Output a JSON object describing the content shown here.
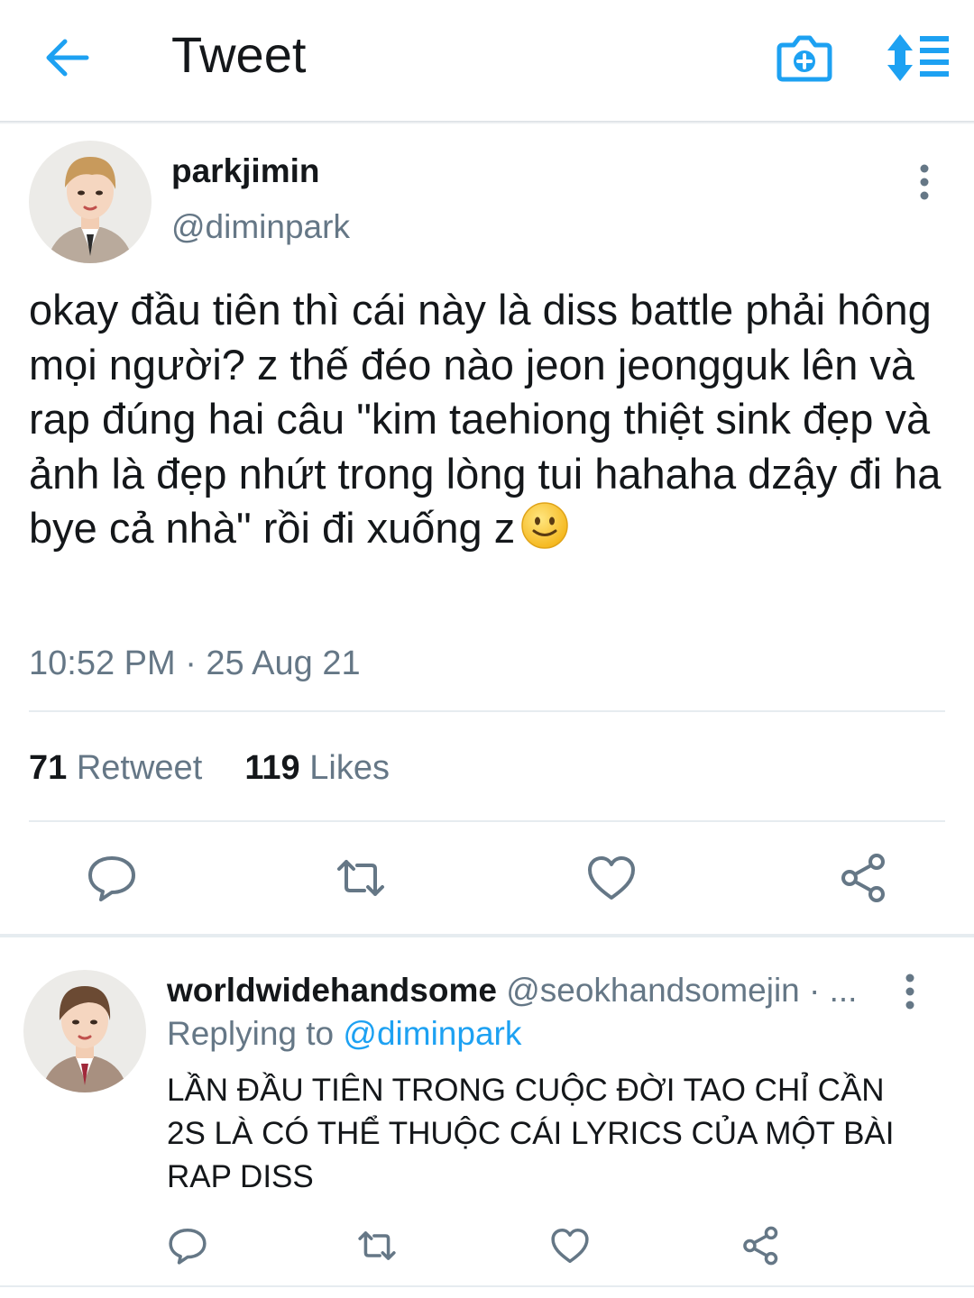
{
  "header": {
    "title": "Tweet",
    "icons": [
      "back-arrow-icon",
      "camera-add-icon",
      "sort-icon"
    ],
    "accent": "#1da1f2"
  },
  "tweet": {
    "author_name": "parkjimin",
    "author_handle": "@diminpark",
    "text": "okay đầu tiên thì cái này là diss battle phải hông mọi người? z thế đéo nào jeon jeongguk lên và rap đúng hai câu \"kim taehiong thiệt sink đẹp và ảnh là đẹp nhứt trong lòng tui hahaha dzậy đi ha bye cả nhà\" rồi đi xuống z",
    "emoji": "slightly-smiling-face",
    "timestamp": "10:52 PM · 25 Aug 21",
    "stats": {
      "retweets_count": "71",
      "retweets_label": "Retweet",
      "likes_count": "119",
      "likes_label": "Likes"
    },
    "actions": [
      "reply-icon",
      "retweet-icon",
      "like-icon",
      "share-icon"
    ]
  },
  "reply": {
    "author_name": "worldwidehandsome",
    "author_handle": "@seokhandsomejin · ...",
    "replying_prefix": "Replying to",
    "replying_to": "@diminpark",
    "text": "LẦN ĐẦU TIÊN TRONG CUỘC ĐỜI TAO CHỈ CẦN 2S LÀ CÓ THỂ THUỘC CÁI LYRICS CỦA MỘT BÀI RAP DISS",
    "actions": [
      "reply-icon",
      "retweet-icon",
      "like-icon",
      "share-icon"
    ]
  },
  "colors": {
    "text_primary": "#14171a",
    "text_secondary": "#657786",
    "link": "#1da1f2",
    "divider": "#e6ecf0"
  }
}
